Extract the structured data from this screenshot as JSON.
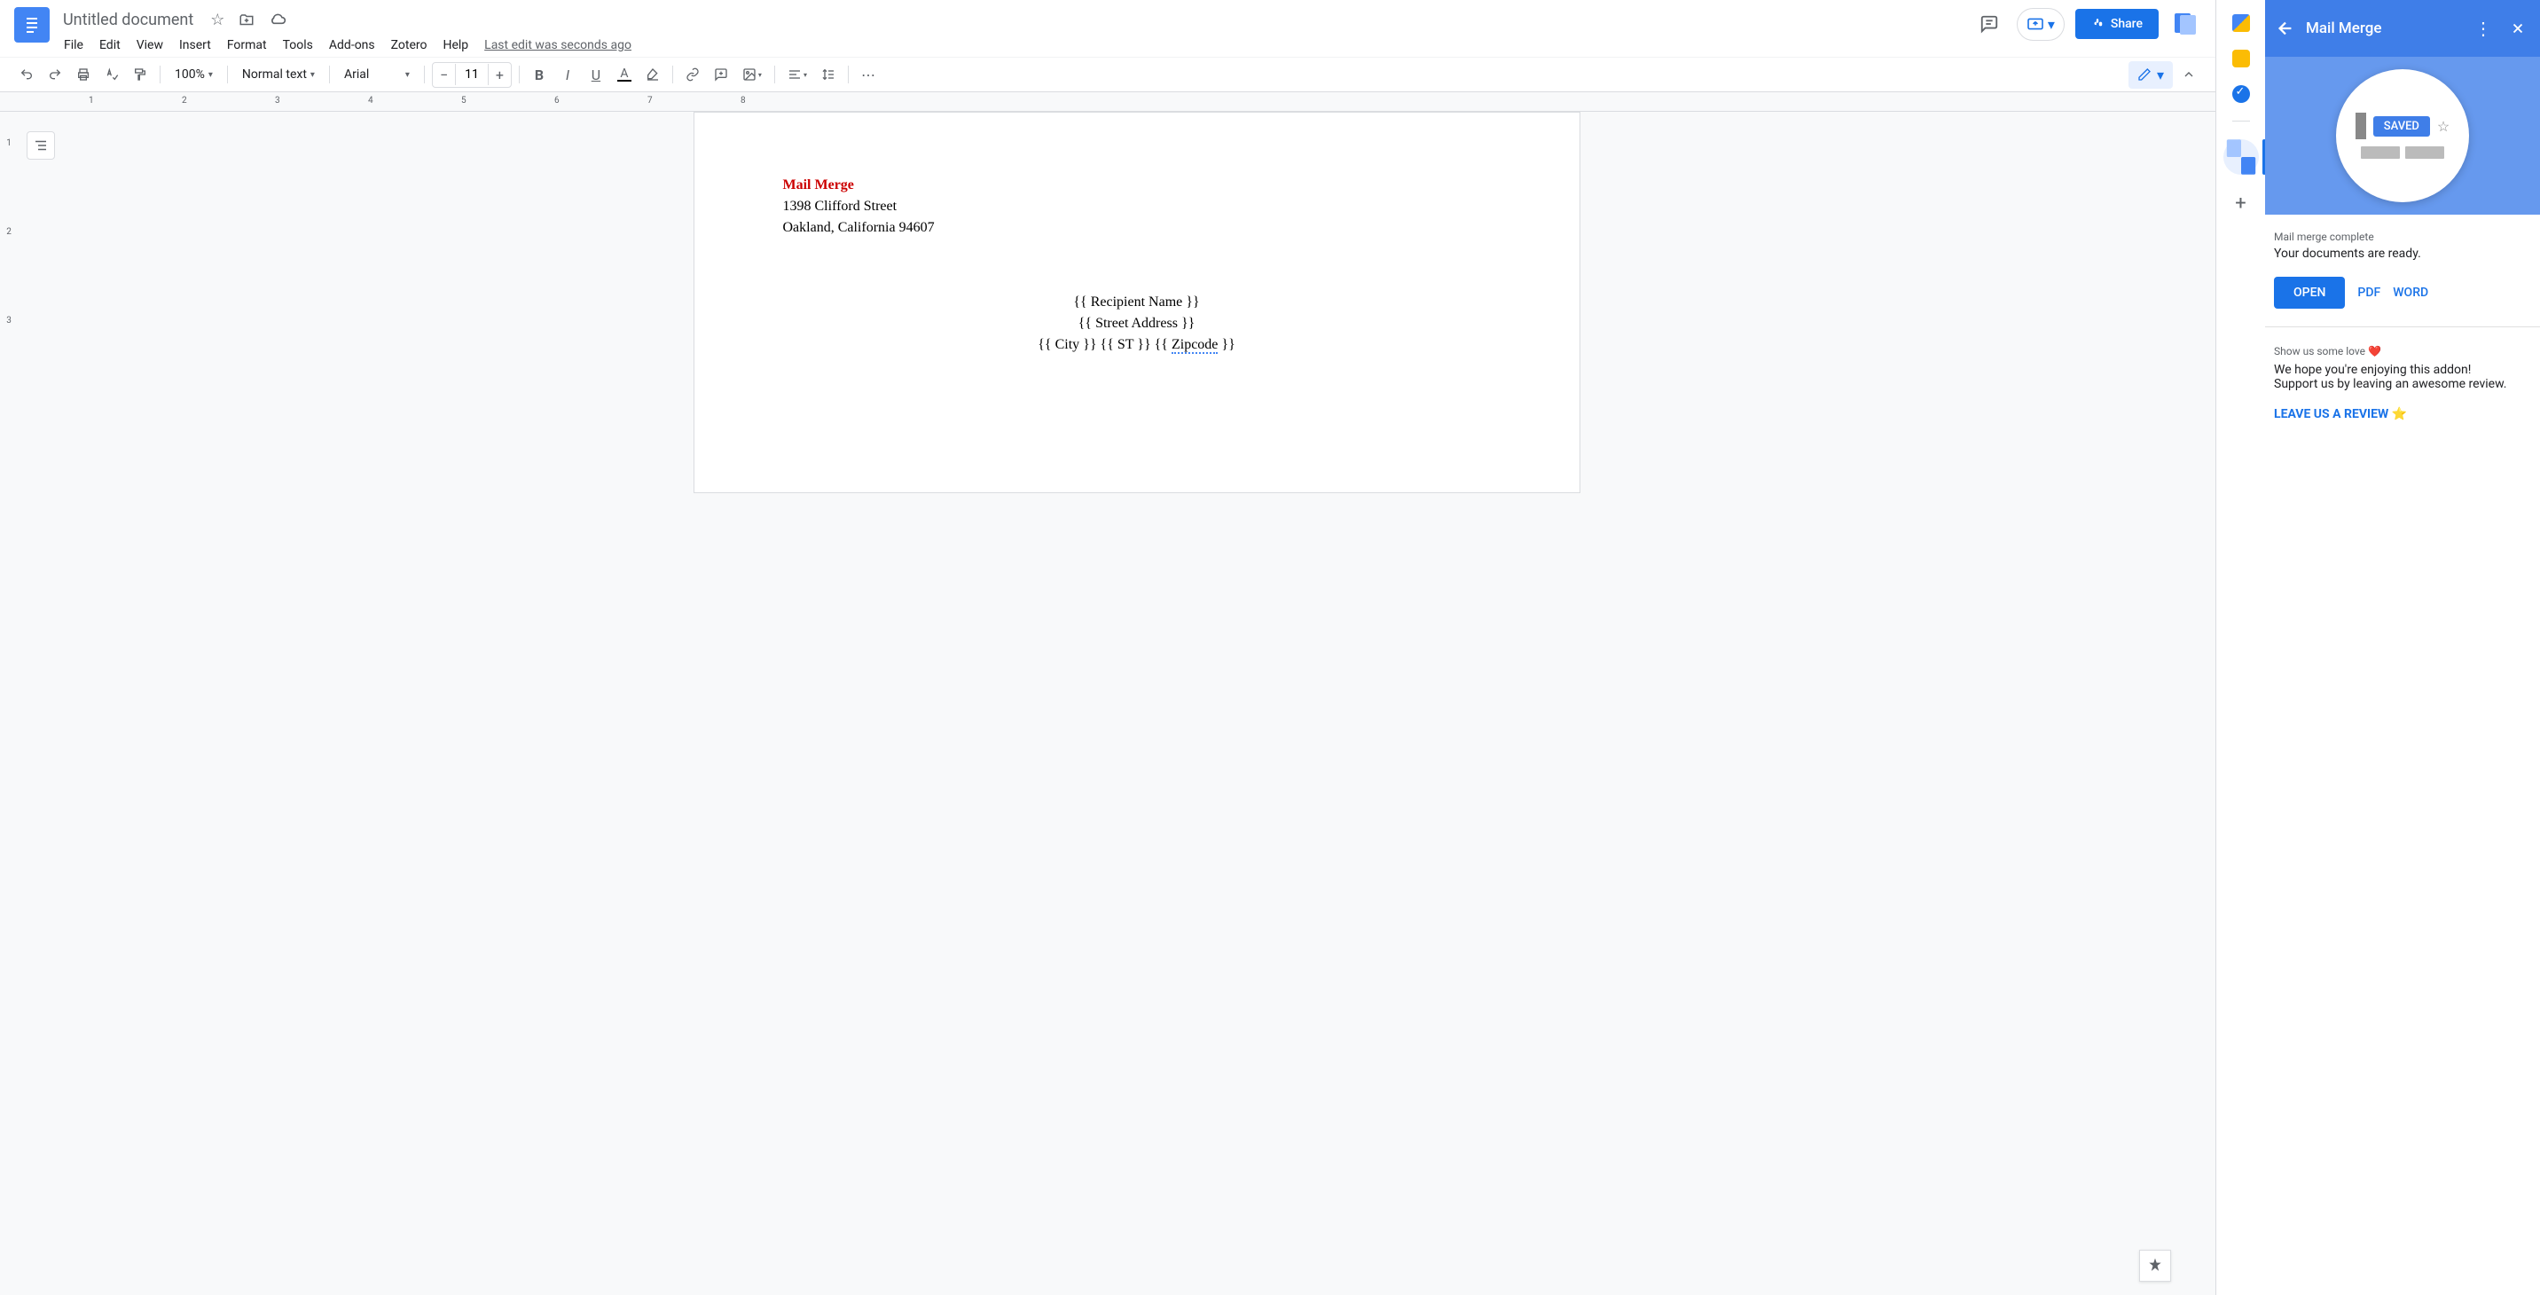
{
  "docTitle": "Untitled document",
  "menus": {
    "file": "File",
    "edit": "Edit",
    "view": "View",
    "insert": "Insert",
    "format": "Format",
    "tools": "Tools",
    "addons": "Add-ons",
    "zotero": "Zotero",
    "help": "Help"
  },
  "lastEdit": "Last edit was seconds ago",
  "shareLabel": "Share",
  "toolbar": {
    "zoom": "100%",
    "styles": "Normal text",
    "font": "Arial",
    "fontSize": "11"
  },
  "ruler": {
    "ticks": [
      "1",
      "2",
      "3",
      "4",
      "5",
      "6",
      "7",
      "8"
    ]
  },
  "vruler": [
    "1",
    "2",
    "3"
  ],
  "document": {
    "line1": "Mail Merge",
    "line2": "1398 Clifford Street",
    "line3": "Oakland, California 94607",
    "r1": "{{ Recipient Name }}",
    "r2": "{{ Street Address }}",
    "r3a": "{{ City }} {{ ST }} {{ ",
    "r3b": "Zipcode",
    "r3c": " }}"
  },
  "addon": {
    "title": "Mail Merge",
    "heroLabel": "SAVED",
    "completeHead": "Mail merge complete",
    "completeMsg": "Your documents are ready.",
    "openBtn": "OPEN",
    "pdfBtn": "PDF",
    "wordBtn": "WORD",
    "loveHead": "Show us some love ❤️",
    "loveLine1": "We hope you're enjoying this addon!",
    "loveLine2": "Support us by leaving an awesome review.",
    "reviewLink": "LEAVE US A REVIEW ⭐"
  }
}
